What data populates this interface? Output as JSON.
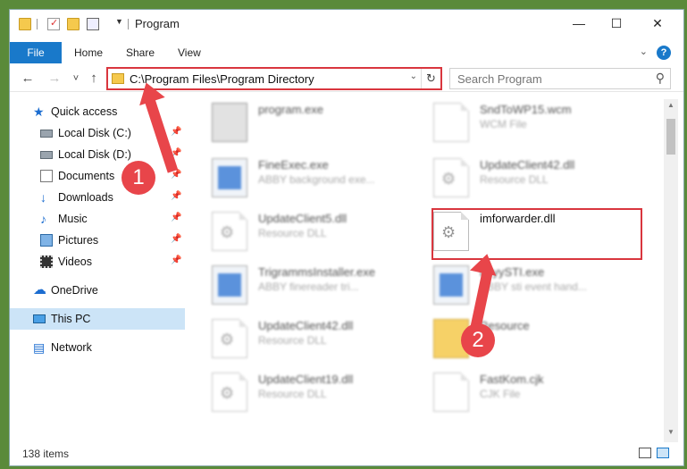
{
  "window": {
    "title": "Program",
    "controls": {
      "minimize": "—",
      "maximize": "☐",
      "close": "✕"
    }
  },
  "ribbon": {
    "tabs": [
      "File",
      "Home",
      "Share",
      "View"
    ],
    "help": "?"
  },
  "nav": {
    "back": "←",
    "forward": "→",
    "recent": "˅",
    "up": "↑",
    "address": "C:\\Program Files\\Program Directory",
    "search_placeholder": "Search Program"
  },
  "sidebar": {
    "items": [
      {
        "label": "Quick access",
        "icon": "star-icon",
        "pinned": false
      },
      {
        "label": "Local Disk (C:)",
        "icon": "drive-icon",
        "pinned": true
      },
      {
        "label": "Local Disk (D:)",
        "icon": "drive-icon",
        "pinned": true
      },
      {
        "label": "Documents",
        "icon": "documents-icon",
        "pinned": true
      },
      {
        "label": "Downloads",
        "icon": "download-icon",
        "pinned": true
      },
      {
        "label": "Music",
        "icon": "music-icon",
        "pinned": true
      },
      {
        "label": "Pictures",
        "icon": "pictures-icon",
        "pinned": true
      },
      {
        "label": "Videos",
        "icon": "videos-icon",
        "pinned": true
      },
      {
        "label": "OneDrive",
        "icon": "cloud-icon",
        "pinned": false
      },
      {
        "label": "This PC",
        "icon": "computer-icon",
        "pinned": false,
        "selected": true
      },
      {
        "label": "Network",
        "icon": "network-icon",
        "pinned": false
      }
    ]
  },
  "files": [
    {
      "name": "program.exe",
      "type": "",
      "icon": "setup-icon"
    },
    {
      "name": "SndToWP15.wcm",
      "type": "WCM File",
      "icon": "document-icon"
    },
    {
      "name": "FineExec.exe",
      "type": "ABBY background exe...",
      "icon": "exe-icon"
    },
    {
      "name": "UpdateClient42.dll",
      "type": "Resource DLL",
      "icon": "dll-icon"
    },
    {
      "name": "UpdateClient5.dll",
      "type": "Resource DLL",
      "icon": "dll-icon"
    },
    {
      "name": "imforwarder.dll",
      "type": "",
      "icon": "dll-icon",
      "highlighted": true
    },
    {
      "name": "TrigrammsInstaller.exe",
      "type": "ABBY finereader tri...",
      "icon": "exe-icon"
    },
    {
      "name": "bbyySTI.exe",
      "type": "ABBY sti event hand...",
      "icon": "exe-icon"
    },
    {
      "name": "UpdateClient42.dll",
      "type": "Resource DLL",
      "icon": "dll-icon"
    },
    {
      "name": "Resource",
      "type": "",
      "icon": "folder-icon"
    },
    {
      "name": "UpdateClient19.dll",
      "type": "Resource DLL",
      "icon": "dll-icon"
    },
    {
      "name": "FastKom.cjk",
      "type": "CJK File",
      "icon": "document-icon"
    }
  ],
  "status": {
    "count": "138 items"
  },
  "callouts": [
    "1",
    "2"
  ],
  "colors": {
    "accent": "#1979ca",
    "callout": "#e8454a",
    "highlight_border": "#d9363e"
  }
}
